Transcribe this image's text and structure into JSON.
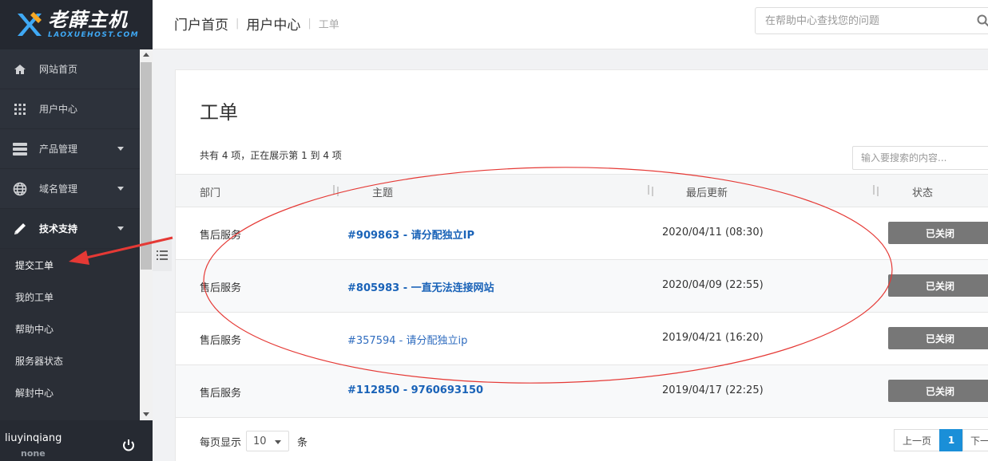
{
  "brand": {
    "name_cn": "老薛主机",
    "name_en": "LAOXUEHOST.COM"
  },
  "sidebar": {
    "items": [
      {
        "label": "网站首页",
        "icon": "home-icon",
        "caret": false
      },
      {
        "label": "用户中心",
        "icon": "grid-icon",
        "caret": false
      },
      {
        "label": "产品管理",
        "icon": "server-icon",
        "caret": true
      },
      {
        "label": "域名管理",
        "icon": "globe-icon",
        "caret": true
      },
      {
        "label": "技术支持",
        "icon": "pencil-icon",
        "caret": true,
        "active": true
      }
    ],
    "subitems": [
      {
        "label": "提交工单"
      },
      {
        "label": "我的工单"
      },
      {
        "label": "帮助中心"
      },
      {
        "label": "服务器状态"
      },
      {
        "label": "解封中心"
      }
    ]
  },
  "user": {
    "name": "liuyinqiang",
    "status": "none"
  },
  "header": {
    "breadcrumb": [
      "门户首页",
      "用户中心",
      "工单"
    ],
    "search_placeholder": "在帮助中心查找您的问题"
  },
  "card": {
    "title": "工单",
    "summary": "共有 4 项，正在展示第 1 到 4 项",
    "search_placeholder": "输入要搜索的内容..."
  },
  "table": {
    "headers": {
      "dept": "部门",
      "subject": "主题",
      "updated": "最后更新",
      "status": "状态"
    },
    "rows": [
      {
        "dept": "售后服务",
        "subject": "#909863 - 请分配独立IP",
        "updated": "2020/04/11 (08:30)",
        "status": "已关闭",
        "bold": true
      },
      {
        "dept": "售后服务",
        "subject": "#805983 - 一直无法连接网站",
        "updated": "2020/04/09 (22:55)",
        "status": "已关闭",
        "bold": true
      },
      {
        "dept": "售后服务",
        "subject": "#357594 - 请分配独立ip",
        "updated": "2019/04/21 (16:20)",
        "status": "已关闭",
        "bold": false
      },
      {
        "dept": "售后服务",
        "subject": "#112850 - 9760693150",
        "updated": "2019/04/17 (22:25)",
        "status": "已关闭",
        "bold": true
      }
    ]
  },
  "pagination": {
    "per_page_label": "每页显示",
    "per_page_value": "10",
    "per_page_unit": "条",
    "prev": "上一页",
    "current": "1",
    "next": "下一"
  },
  "colors": {
    "sidebar": "#2d323b",
    "link": "#1a63b8",
    "badge": "#777777",
    "annotation": "#e53935",
    "page_active": "#1a8fd8"
  }
}
